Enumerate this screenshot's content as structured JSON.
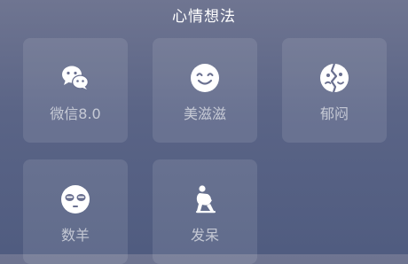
{
  "header": {
    "title": "心情想法"
  },
  "tiles": [
    {
      "label": "微信8.0",
      "icon": "wechat-icon"
    },
    {
      "label": "美滋滋",
      "icon": "smile-icon"
    },
    {
      "label": "郁闷",
      "icon": "split-face-icon"
    },
    {
      "label": "数羊",
      "icon": "sleepy-face-icon"
    },
    {
      "label": "发呆",
      "icon": "squatting-person-icon"
    }
  ],
  "colors": {
    "icon": "#ffffff",
    "label": "#c5c9d8"
  }
}
